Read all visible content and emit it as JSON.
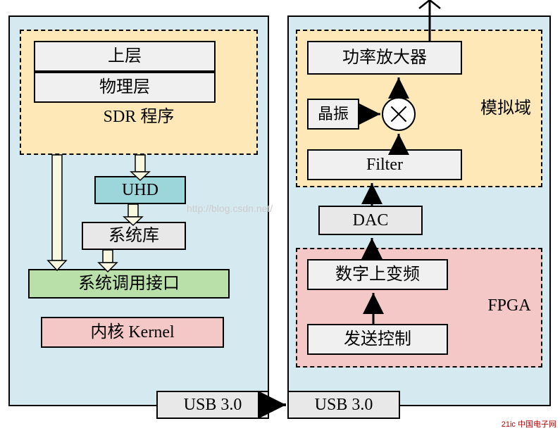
{
  "watermark": "http://blog.csdn.net/",
  "logo": "21ic 中国电子网",
  "left": {
    "upper_layer": "上层",
    "phy_layer": "物理层",
    "sdr_program": "SDR 程序",
    "uhd": "UHD",
    "syslib": "系统库",
    "syscall": "系统调用接口",
    "kernel": "内核 Kernel",
    "usb": "USB 3.0"
  },
  "right": {
    "amplifier": "功率放大器",
    "crystal": "晶振",
    "filter": "Filter",
    "analog_domain": "模拟域",
    "dac": "DAC",
    "up_conversion": "数字上变频",
    "tx_control": "发送控制",
    "fpga": "FPGA",
    "usb": "USB 3.0"
  }
}
